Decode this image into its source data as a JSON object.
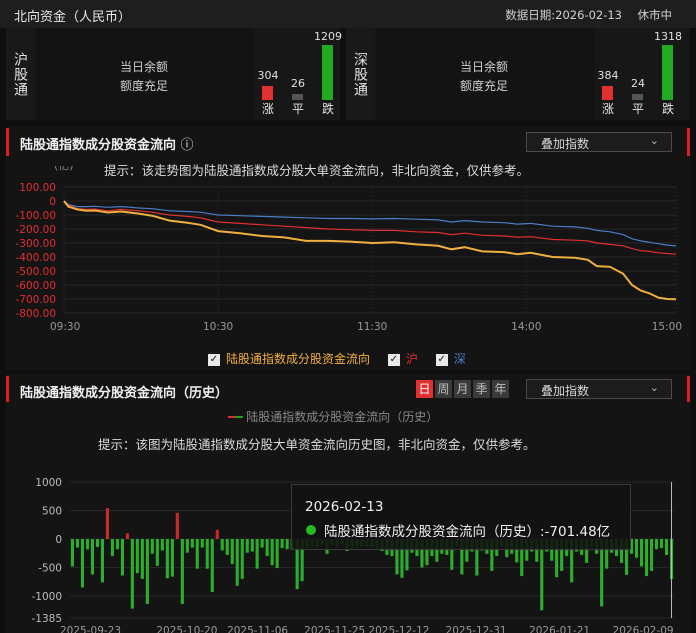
{
  "header": {
    "title": "北向资金（人民币）",
    "date_label": "数据日期:2026-02-13",
    "status": "休市中"
  },
  "sh_panel": {
    "label": "沪股通",
    "balance_label": "当日余额",
    "balance_value": "额度充足",
    "stats": [
      {
        "label": "涨",
        "value": "304",
        "color": "#e03030"
      },
      {
        "label": "平",
        "value": "26",
        "color": "#555555"
      },
      {
        "label": "跌",
        "value": "1209",
        "color": "#22aa22"
      }
    ]
  },
  "sz_panel": {
    "label": "深股通",
    "balance_label": "当日余额",
    "balance_value": "额度充足",
    "stats": [
      {
        "label": "涨",
        "value": "384",
        "color": "#e03030"
      },
      {
        "label": "平",
        "value": "24",
        "color": "#555555"
      },
      {
        "label": "跌",
        "value": "1318",
        "color": "#22aa22"
      }
    ]
  },
  "intraday": {
    "title": "陆股通指数成分股资金流向",
    "info_icon": "info-circle-icon",
    "overlay_label": "叠加指数",
    "hint": "提示：该走势图为陆股通指数成分股大单资金流向，非北向资金，仅供参考。",
    "unit": "(亿)",
    "legend": [
      {
        "label": "陆股通指数成分股资金流向",
        "color": "#f0b040",
        "checked": true
      },
      {
        "label": "沪",
        "color": "#e03030",
        "checked": true
      },
      {
        "label": "深",
        "color": "#4a7ec8",
        "checked": true
      }
    ]
  },
  "history": {
    "title": "陆股通指数成分股资金流向（历史）",
    "tabs": [
      "日",
      "周",
      "月",
      "季",
      "年"
    ],
    "active_tab": "日",
    "overlay_label": "叠加指数",
    "legend_label": "陆股通指数成分股资金流向（历史）",
    "hint": "提示：该图为陆股通指数成分股大单资金流向历史图，非北向资金，仅供参考。",
    "tooltip_date": "2026-02-13",
    "tooltip_text": "陆股通指数成分股资金流向（历史）:-701.48亿"
  },
  "chart_data": [
    {
      "type": "line",
      "title": "陆股通指数成分股资金流向",
      "ylabel": "(亿)",
      "x_ticks": [
        "09:30",
        "10:30",
        "11:30",
        "14:00",
        "15:00"
      ],
      "y_ticks": [
        "100.00",
        "0",
        "-100.00",
        "-200.00",
        "-300.00",
        "-400.00",
        "-500.00",
        "-600.00",
        "-700.00",
        "-800.00"
      ],
      "ylim": [
        -800,
        100
      ],
      "series": [
        {
          "name": "陆股通指数成分股资金流向",
          "color": "#f0b040",
          "points": [
            [
              0,
              0
            ],
            [
              2,
              -40
            ],
            [
              6,
              -60
            ],
            [
              10,
              -70
            ],
            [
              14,
              -68
            ],
            [
              20,
              -82
            ],
            [
              26,
              -75
            ],
            [
              34,
              -90
            ],
            [
              40,
              -105
            ],
            [
              48,
              -140
            ],
            [
              56,
              -155
            ],
            [
              62,
              -170
            ],
            [
              70,
              -215
            ],
            [
              80,
              -230
            ],
            [
              90,
              -250
            ],
            [
              100,
              -260
            ],
            [
              110,
              -285
            ],
            [
              120,
              -285
            ],
            [
              130,
              -290
            ],
            [
              140,
              -300
            ],
            [
              150,
              -295
            ],
            [
              160,
              -310
            ],
            [
              170,
              -320
            ],
            [
              176,
              -345
            ],
            [
              182,
              -330
            ],
            [
              190,
              -360
            ],
            [
              200,
              -365
            ],
            [
              206,
              -380
            ],
            [
              212,
              -370
            ],
            [
              222,
              -400
            ],
            [
              232,
              -405
            ],
            [
              238,
              -420
            ],
            [
              242,
              -465
            ],
            [
              248,
              -470
            ],
            [
              254,
              -520
            ],
            [
              258,
              -600
            ],
            [
              262,
              -640
            ],
            [
              266,
              -660
            ],
            [
              270,
              -690
            ],
            [
              274,
              -700
            ],
            [
              278,
              -701.48
            ]
          ]
        },
        {
          "name": "沪",
          "color": "#e03030",
          "points": [
            [
              0,
              0
            ],
            [
              2,
              -30
            ],
            [
              6,
              -55
            ],
            [
              10,
              -60
            ],
            [
              14,
              -58
            ],
            [
              20,
              -70
            ],
            [
              26,
              -60
            ],
            [
              34,
              -70
            ],
            [
              40,
              -80
            ],
            [
              48,
              -100
            ],
            [
              56,
              -110
            ],
            [
              62,
              -120
            ],
            [
              70,
              -150
            ],
            [
              80,
              -160
            ],
            [
              90,
              -170
            ],
            [
              100,
              -180
            ],
            [
              110,
              -190
            ],
            [
              120,
              -200
            ],
            [
              130,
              -205
            ],
            [
              140,
              -210
            ],
            [
              150,
              -210
            ],
            [
              160,
              -220
            ],
            [
              170,
              -225
            ],
            [
              176,
              -240
            ],
            [
              182,
              -230
            ],
            [
              190,
              -245
            ],
            [
              200,
              -250
            ],
            [
              206,
              -258
            ],
            [
              212,
              -255
            ],
            [
              222,
              -275
            ],
            [
              232,
              -280
            ],
            [
              238,
              -285
            ],
            [
              242,
              -300
            ],
            [
              248,
              -310
            ],
            [
              254,
              -320
            ],
            [
              258,
              -340
            ],
            [
              262,
              -355
            ],
            [
              266,
              -360
            ],
            [
              270,
              -370
            ],
            [
              274,
              -375
            ],
            [
              278,
              -380
            ]
          ]
        },
        {
          "name": "深",
          "color": "#4a7ec8",
          "points": [
            [
              0,
              0
            ],
            [
              2,
              -25
            ],
            [
              6,
              -40
            ],
            [
              10,
              -40
            ],
            [
              14,
              -38
            ],
            [
              20,
              -45
            ],
            [
              26,
              -40
            ],
            [
              34,
              -50
            ],
            [
              40,
              -55
            ],
            [
              48,
              -70
            ],
            [
              56,
              -75
            ],
            [
              62,
              -80
            ],
            [
              70,
              -100
            ],
            [
              80,
              -105
            ],
            [
              90,
              -110
            ],
            [
              100,
              -115
            ],
            [
              110,
              -120
            ],
            [
              120,
              -125
            ],
            [
              130,
              -125
            ],
            [
              140,
              -128
            ],
            [
              150,
              -125
            ],
            [
              160,
              -130
            ],
            [
              170,
              -135
            ],
            [
              176,
              -150
            ],
            [
              182,
              -140
            ],
            [
              190,
              -150
            ],
            [
              200,
              -155
            ],
            [
              206,
              -165
            ],
            [
              212,
              -160
            ],
            [
              222,
              -180
            ],
            [
              232,
              -185
            ],
            [
              238,
              -195
            ],
            [
              242,
              -210
            ],
            [
              248,
              -220
            ],
            [
              254,
              -240
            ],
            [
              258,
              -270
            ],
            [
              262,
              -285
            ],
            [
              266,
              -295
            ],
            [
              270,
              -305
            ],
            [
              274,
              -315
            ],
            [
              278,
              -321
            ]
          ]
        }
      ]
    },
    {
      "type": "bar",
      "title": "陆股通指数成分股资金流向（历史）",
      "y_ticks": [
        "1000",
        "500",
        "0",
        "-500",
        "-1000",
        "-1385"
      ],
      "ylim": [
        -1385,
        1000
      ],
      "x_ticks": [
        "2025-09-23",
        "2025-10-20",
        "2025-11-06",
        "2025-11-25",
        "2025-12-12",
        "2025-12-31",
        "2026-01-21",
        "2026-02-09"
      ],
      "values": [
        -480,
        -150,
        -850,
        -180,
        -620,
        -140,
        -760,
        540,
        -300,
        -180,
        -640,
        100,
        -1220,
        -600,
        -700,
        -1140,
        -260,
        -470,
        -200,
        -690,
        -660,
        460,
        -1140,
        -240,
        -150,
        -520,
        -150,
        -520,
        -930,
        160,
        -200,
        -280,
        -440,
        -820,
        -700,
        -240,
        -220,
        -520,
        -150,
        -300,
        -460,
        -510,
        -160,
        -180,
        -180,
        -880,
        -740,
        -160,
        -120,
        -140,
        -100,
        -260,
        -110,
        -140,
        -90,
        -210,
        -160,
        -120,
        -130,
        -140,
        -140,
        -170,
        -210,
        -280,
        -300,
        -620,
        -680,
        -550,
        -240,
        -300,
        -500,
        -460,
        -300,
        -400,
        -260,
        -280,
        -540,
        -140,
        -620,
        -400,
        -220,
        -640,
        -200,
        -260,
        -560,
        -300,
        -140,
        -320,
        -260,
        -410,
        -650,
        -380,
        -220,
        -400,
        -1250,
        -220,
        -380,
        -670,
        -560,
        -300,
        -760,
        -220,
        -280,
        -420,
        -140,
        -260,
        -1180,
        -520,
        -240,
        -300,
        -420,
        -630,
        -260,
        -330,
        -480,
        -650,
        -560,
        -180,
        -160,
        -280,
        -701.48
      ],
      "highlight_last": true
    }
  ]
}
